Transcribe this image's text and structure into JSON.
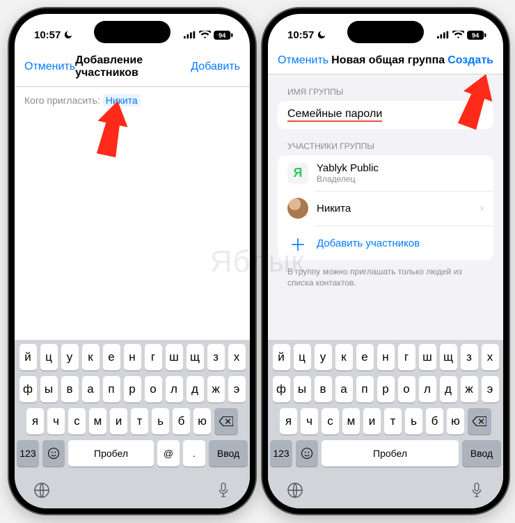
{
  "status": {
    "time": "10:57",
    "battery": "94"
  },
  "left": {
    "nav": {
      "cancel": "Отменить",
      "title": "Добавление участников",
      "action": "Добавить"
    },
    "invite_label": "Кого пригласить:",
    "invite_name": "Никита"
  },
  "right": {
    "nav": {
      "cancel": "Отменить",
      "title": "Новая общая группа",
      "action": "Создать"
    },
    "section_group_name": "ИМЯ ГРУППЫ",
    "group_name_value": "Семейные пароли",
    "section_members": "УЧАСТНИКИ ГРУППЫ",
    "members": [
      {
        "badge": "Я",
        "name": "Yablyk Public",
        "role": "Владелец"
      },
      {
        "name": "Никита"
      }
    ],
    "add_members": "Добавить участников",
    "footer": "В группу можно приглашать только людей из списка контактов."
  },
  "keyboard": {
    "row1": [
      "й",
      "ц",
      "у",
      "к",
      "е",
      "н",
      "г",
      "ш",
      "щ",
      "з",
      "х"
    ],
    "row2": [
      "ф",
      "ы",
      "в",
      "а",
      "п",
      "р",
      "о",
      "л",
      "д",
      "ж",
      "э"
    ],
    "row3": [
      "я",
      "ч",
      "с",
      "м",
      "и",
      "т",
      "ь",
      "б",
      "ю"
    ],
    "num": "123",
    "space": "Пробел",
    "at": "@",
    "dot": ".",
    "enter": "Ввод"
  },
  "watermark": "Яблык"
}
